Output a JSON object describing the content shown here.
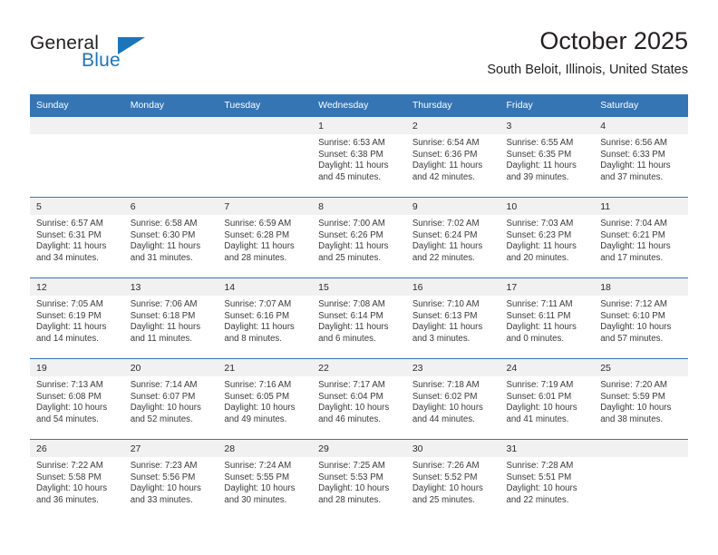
{
  "brand": {
    "name_part1": "General",
    "name_part2": "Blue",
    "triangle_icon": "triangle-icon",
    "accent_color": "#1b75bb"
  },
  "header": {
    "title": "October 2025",
    "subtitle": "South Beloit, Illinois, United States"
  },
  "theme": {
    "header_row_bg": "#3675b4",
    "daynum_band_bg": "#f1f1f1",
    "row_divider": "#3675b4",
    "text_color": "#2b2b2b"
  },
  "calendar": {
    "weekday_headers": [
      "Sunday",
      "Monday",
      "Tuesday",
      "Wednesday",
      "Thursday",
      "Friday",
      "Saturday"
    ],
    "labels": {
      "sunrise_prefix": "Sunrise:",
      "sunset_prefix": "Sunset:",
      "daylight_prefix": "Daylight:"
    },
    "weeks": [
      [
        {
          "day": "",
          "sunrise": "",
          "sunset": "",
          "daylight": ""
        },
        {
          "day": "",
          "sunrise": "",
          "sunset": "",
          "daylight": ""
        },
        {
          "day": "",
          "sunrise": "",
          "sunset": "",
          "daylight": ""
        },
        {
          "day": "1",
          "sunrise": "Sunrise: 6:53 AM",
          "sunset": "Sunset: 6:38 PM",
          "daylight": "Daylight: 11 hours and 45 minutes."
        },
        {
          "day": "2",
          "sunrise": "Sunrise: 6:54 AM",
          "sunset": "Sunset: 6:36 PM",
          "daylight": "Daylight: 11 hours and 42 minutes."
        },
        {
          "day": "3",
          "sunrise": "Sunrise: 6:55 AM",
          "sunset": "Sunset: 6:35 PM",
          "daylight": "Daylight: 11 hours and 39 minutes."
        },
        {
          "day": "4",
          "sunrise": "Sunrise: 6:56 AM",
          "sunset": "Sunset: 6:33 PM",
          "daylight": "Daylight: 11 hours and 37 minutes."
        }
      ],
      [
        {
          "day": "5",
          "sunrise": "Sunrise: 6:57 AM",
          "sunset": "Sunset: 6:31 PM",
          "daylight": "Daylight: 11 hours and 34 minutes."
        },
        {
          "day": "6",
          "sunrise": "Sunrise: 6:58 AM",
          "sunset": "Sunset: 6:30 PM",
          "daylight": "Daylight: 11 hours and 31 minutes."
        },
        {
          "day": "7",
          "sunrise": "Sunrise: 6:59 AM",
          "sunset": "Sunset: 6:28 PM",
          "daylight": "Daylight: 11 hours and 28 minutes."
        },
        {
          "day": "8",
          "sunrise": "Sunrise: 7:00 AM",
          "sunset": "Sunset: 6:26 PM",
          "daylight": "Daylight: 11 hours and 25 minutes."
        },
        {
          "day": "9",
          "sunrise": "Sunrise: 7:02 AM",
          "sunset": "Sunset: 6:24 PM",
          "daylight": "Daylight: 11 hours and 22 minutes."
        },
        {
          "day": "10",
          "sunrise": "Sunrise: 7:03 AM",
          "sunset": "Sunset: 6:23 PM",
          "daylight": "Daylight: 11 hours and 20 minutes."
        },
        {
          "day": "11",
          "sunrise": "Sunrise: 7:04 AM",
          "sunset": "Sunset: 6:21 PM",
          "daylight": "Daylight: 11 hours and 17 minutes."
        }
      ],
      [
        {
          "day": "12",
          "sunrise": "Sunrise: 7:05 AM",
          "sunset": "Sunset: 6:19 PM",
          "daylight": "Daylight: 11 hours and 14 minutes."
        },
        {
          "day": "13",
          "sunrise": "Sunrise: 7:06 AM",
          "sunset": "Sunset: 6:18 PM",
          "daylight": "Daylight: 11 hours and 11 minutes."
        },
        {
          "day": "14",
          "sunrise": "Sunrise: 7:07 AM",
          "sunset": "Sunset: 6:16 PM",
          "daylight": "Daylight: 11 hours and 8 minutes."
        },
        {
          "day": "15",
          "sunrise": "Sunrise: 7:08 AM",
          "sunset": "Sunset: 6:14 PM",
          "daylight": "Daylight: 11 hours and 6 minutes."
        },
        {
          "day": "16",
          "sunrise": "Sunrise: 7:10 AM",
          "sunset": "Sunset: 6:13 PM",
          "daylight": "Daylight: 11 hours and 3 minutes."
        },
        {
          "day": "17",
          "sunrise": "Sunrise: 7:11 AM",
          "sunset": "Sunset: 6:11 PM",
          "daylight": "Daylight: 11 hours and 0 minutes."
        },
        {
          "day": "18",
          "sunrise": "Sunrise: 7:12 AM",
          "sunset": "Sunset: 6:10 PM",
          "daylight": "Daylight: 10 hours and 57 minutes."
        }
      ],
      [
        {
          "day": "19",
          "sunrise": "Sunrise: 7:13 AM",
          "sunset": "Sunset: 6:08 PM",
          "daylight": "Daylight: 10 hours and 54 minutes."
        },
        {
          "day": "20",
          "sunrise": "Sunrise: 7:14 AM",
          "sunset": "Sunset: 6:07 PM",
          "daylight": "Daylight: 10 hours and 52 minutes."
        },
        {
          "day": "21",
          "sunrise": "Sunrise: 7:16 AM",
          "sunset": "Sunset: 6:05 PM",
          "daylight": "Daylight: 10 hours and 49 minutes."
        },
        {
          "day": "22",
          "sunrise": "Sunrise: 7:17 AM",
          "sunset": "Sunset: 6:04 PM",
          "daylight": "Daylight: 10 hours and 46 minutes."
        },
        {
          "day": "23",
          "sunrise": "Sunrise: 7:18 AM",
          "sunset": "Sunset: 6:02 PM",
          "daylight": "Daylight: 10 hours and 44 minutes."
        },
        {
          "day": "24",
          "sunrise": "Sunrise: 7:19 AM",
          "sunset": "Sunset: 6:01 PM",
          "daylight": "Daylight: 10 hours and 41 minutes."
        },
        {
          "day": "25",
          "sunrise": "Sunrise: 7:20 AM",
          "sunset": "Sunset: 5:59 PM",
          "daylight": "Daylight: 10 hours and 38 minutes."
        }
      ],
      [
        {
          "day": "26",
          "sunrise": "Sunrise: 7:22 AM",
          "sunset": "Sunset: 5:58 PM",
          "daylight": "Daylight: 10 hours and 36 minutes."
        },
        {
          "day": "27",
          "sunrise": "Sunrise: 7:23 AM",
          "sunset": "Sunset: 5:56 PM",
          "daylight": "Daylight: 10 hours and 33 minutes."
        },
        {
          "day": "28",
          "sunrise": "Sunrise: 7:24 AM",
          "sunset": "Sunset: 5:55 PM",
          "daylight": "Daylight: 10 hours and 30 minutes."
        },
        {
          "day": "29",
          "sunrise": "Sunrise: 7:25 AM",
          "sunset": "Sunset: 5:53 PM",
          "daylight": "Daylight: 10 hours and 28 minutes."
        },
        {
          "day": "30",
          "sunrise": "Sunrise: 7:26 AM",
          "sunset": "Sunset: 5:52 PM",
          "daylight": "Daylight: 10 hours and 25 minutes."
        },
        {
          "day": "31",
          "sunrise": "Sunrise: 7:28 AM",
          "sunset": "Sunset: 5:51 PM",
          "daylight": "Daylight: 10 hours and 22 minutes."
        },
        {
          "day": "",
          "sunrise": "",
          "sunset": "",
          "daylight": ""
        }
      ]
    ]
  }
}
